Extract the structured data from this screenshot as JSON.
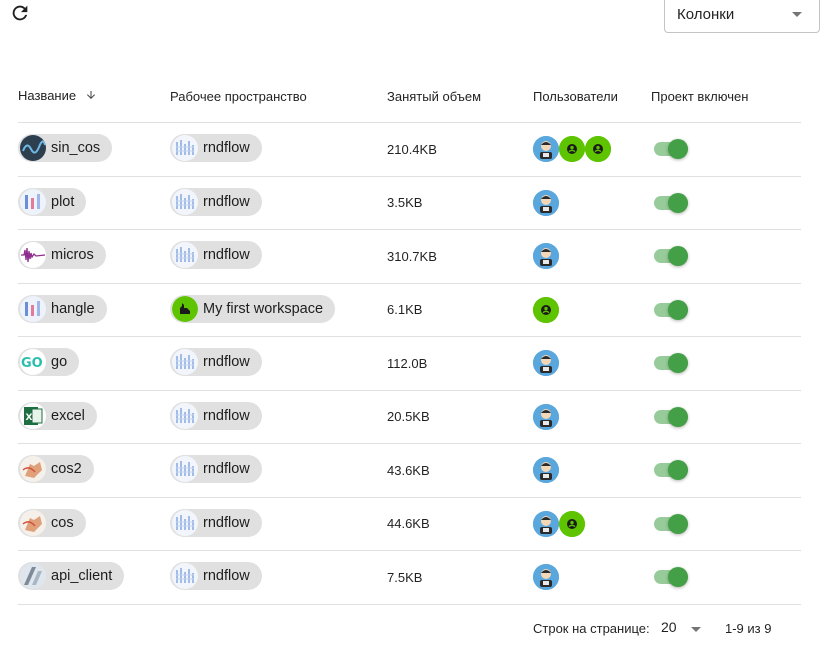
{
  "toolbar": {
    "refresh_icon": "refresh-icon"
  },
  "columns_select": {
    "label": "Колонки"
  },
  "table": {
    "headers": {
      "name": "Название",
      "workspace": "Рабочее пространство",
      "size": "Занятый объем",
      "users": "Пользователи",
      "enabled": "Проект включен"
    },
    "sort": {
      "column": "name",
      "direction": "descending"
    },
    "rows": [
      {
        "name": "sin_cos",
        "icon": "waveform-dark",
        "workspace": "rndflow",
        "workspace_icon": "rndflow",
        "size": "210.4KB",
        "users": [
          "photo",
          "green",
          "green"
        ],
        "enabled": true
      },
      {
        "name": "plot",
        "icon": "plot-thumb",
        "workspace": "rndflow",
        "workspace_icon": "rndflow",
        "size": "3.5KB",
        "users": [
          "photo"
        ],
        "enabled": true
      },
      {
        "name": "micros",
        "icon": "waveform-purple",
        "workspace": "rndflow",
        "workspace_icon": "rndflow",
        "size": "310.7KB",
        "users": [
          "photo"
        ],
        "enabled": true
      },
      {
        "name": "hangle",
        "icon": "plot-thumb",
        "workspace": "My first workspace",
        "workspace_icon": "green",
        "size": "6.1KB",
        "users": [
          "green"
        ],
        "enabled": true
      },
      {
        "name": "go",
        "icon": "go-logo",
        "workspace": "rndflow",
        "workspace_icon": "rndflow",
        "size": "112.0B",
        "users": [
          "photo"
        ],
        "enabled": true
      },
      {
        "name": "excel",
        "icon": "excel-logo",
        "workspace": "rndflow",
        "workspace_icon": "rndflow",
        "size": "20.5KB",
        "users": [
          "photo"
        ],
        "enabled": true
      },
      {
        "name": "cos2",
        "icon": "hand-thumb",
        "workspace": "rndflow",
        "workspace_icon": "rndflow",
        "size": "43.6KB",
        "users": [
          "photo"
        ],
        "enabled": true
      },
      {
        "name": "cos",
        "icon": "hand-thumb",
        "workspace": "rndflow",
        "workspace_icon": "rndflow",
        "size": "44.6KB",
        "users": [
          "photo",
          "green"
        ],
        "enabled": true
      },
      {
        "name": "api_client",
        "icon": "api-thumb",
        "workspace": "rndflow",
        "workspace_icon": "rndflow",
        "size": "7.5KB",
        "users": [
          "photo"
        ],
        "enabled": true
      }
    ]
  },
  "pagination": {
    "rows_per_page_label": "Строк на странице:",
    "rows_per_page": "20",
    "range": "1-9 из 9"
  },
  "colors": {
    "accent_green": "#43a047",
    "user_green": "#5ec400",
    "user_photo_bg": "#5aa7de",
    "chip_bg": "#e0e0e0"
  }
}
